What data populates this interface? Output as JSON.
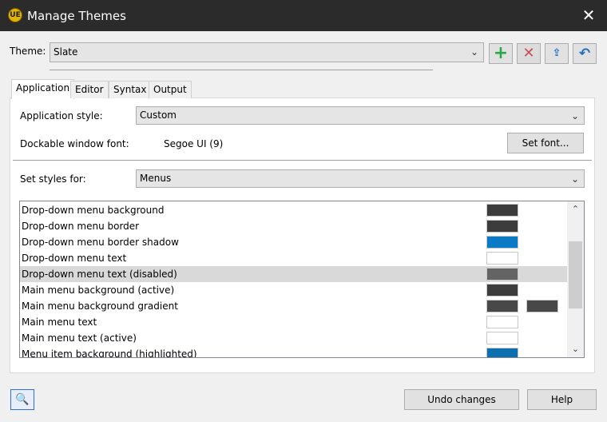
{
  "window": {
    "title": "Manage Themes",
    "icon_text": "UE",
    "close_glyph": "✕"
  },
  "theme_row": {
    "label": "Theme:",
    "value": "Slate"
  },
  "toolbar": {
    "add_icon": "+",
    "delete_icon": "✕",
    "export_icon": "⇪",
    "revert_icon": "↶"
  },
  "tabs": [
    {
      "label": "Application"
    },
    {
      "label": "Editor"
    },
    {
      "label": "Syntax"
    },
    {
      "label": "Output"
    }
  ],
  "application": {
    "style_label": "Application style:",
    "style_value": "Custom",
    "font_label": "Dockable window font:",
    "font_value": "Segoe UI (9)",
    "set_font_button": "Set font...",
    "set_styles_label": "Set styles for:",
    "set_styles_value": "Menus"
  },
  "style_items": [
    {
      "label": "Drop-down menu background",
      "color": "#3c3c3c"
    },
    {
      "label": "Drop-down menu border",
      "color": "#3c3c3c"
    },
    {
      "label": "Drop-down menu border shadow",
      "color": "#0a7ac4"
    },
    {
      "label": "Drop-down menu text",
      "color": "#ffffff"
    },
    {
      "label": "Drop-down menu text (disabled)",
      "color": "#646464",
      "selected": true
    },
    {
      "label": "Main menu background (active)",
      "color": "#3c3c3c"
    },
    {
      "label": "Main menu background gradient",
      "color": "#484848",
      "color2": "#484848"
    },
    {
      "label": "Main menu text",
      "color": "#ffffff"
    },
    {
      "label": "Main menu text (active)",
      "color": "#ffffff"
    },
    {
      "label": "Menu item background (highlighted)",
      "color": "#0d6fad"
    }
  ],
  "footer": {
    "undo_button": "Undo changes",
    "help_button": "Help",
    "search_icon": "🔍"
  }
}
